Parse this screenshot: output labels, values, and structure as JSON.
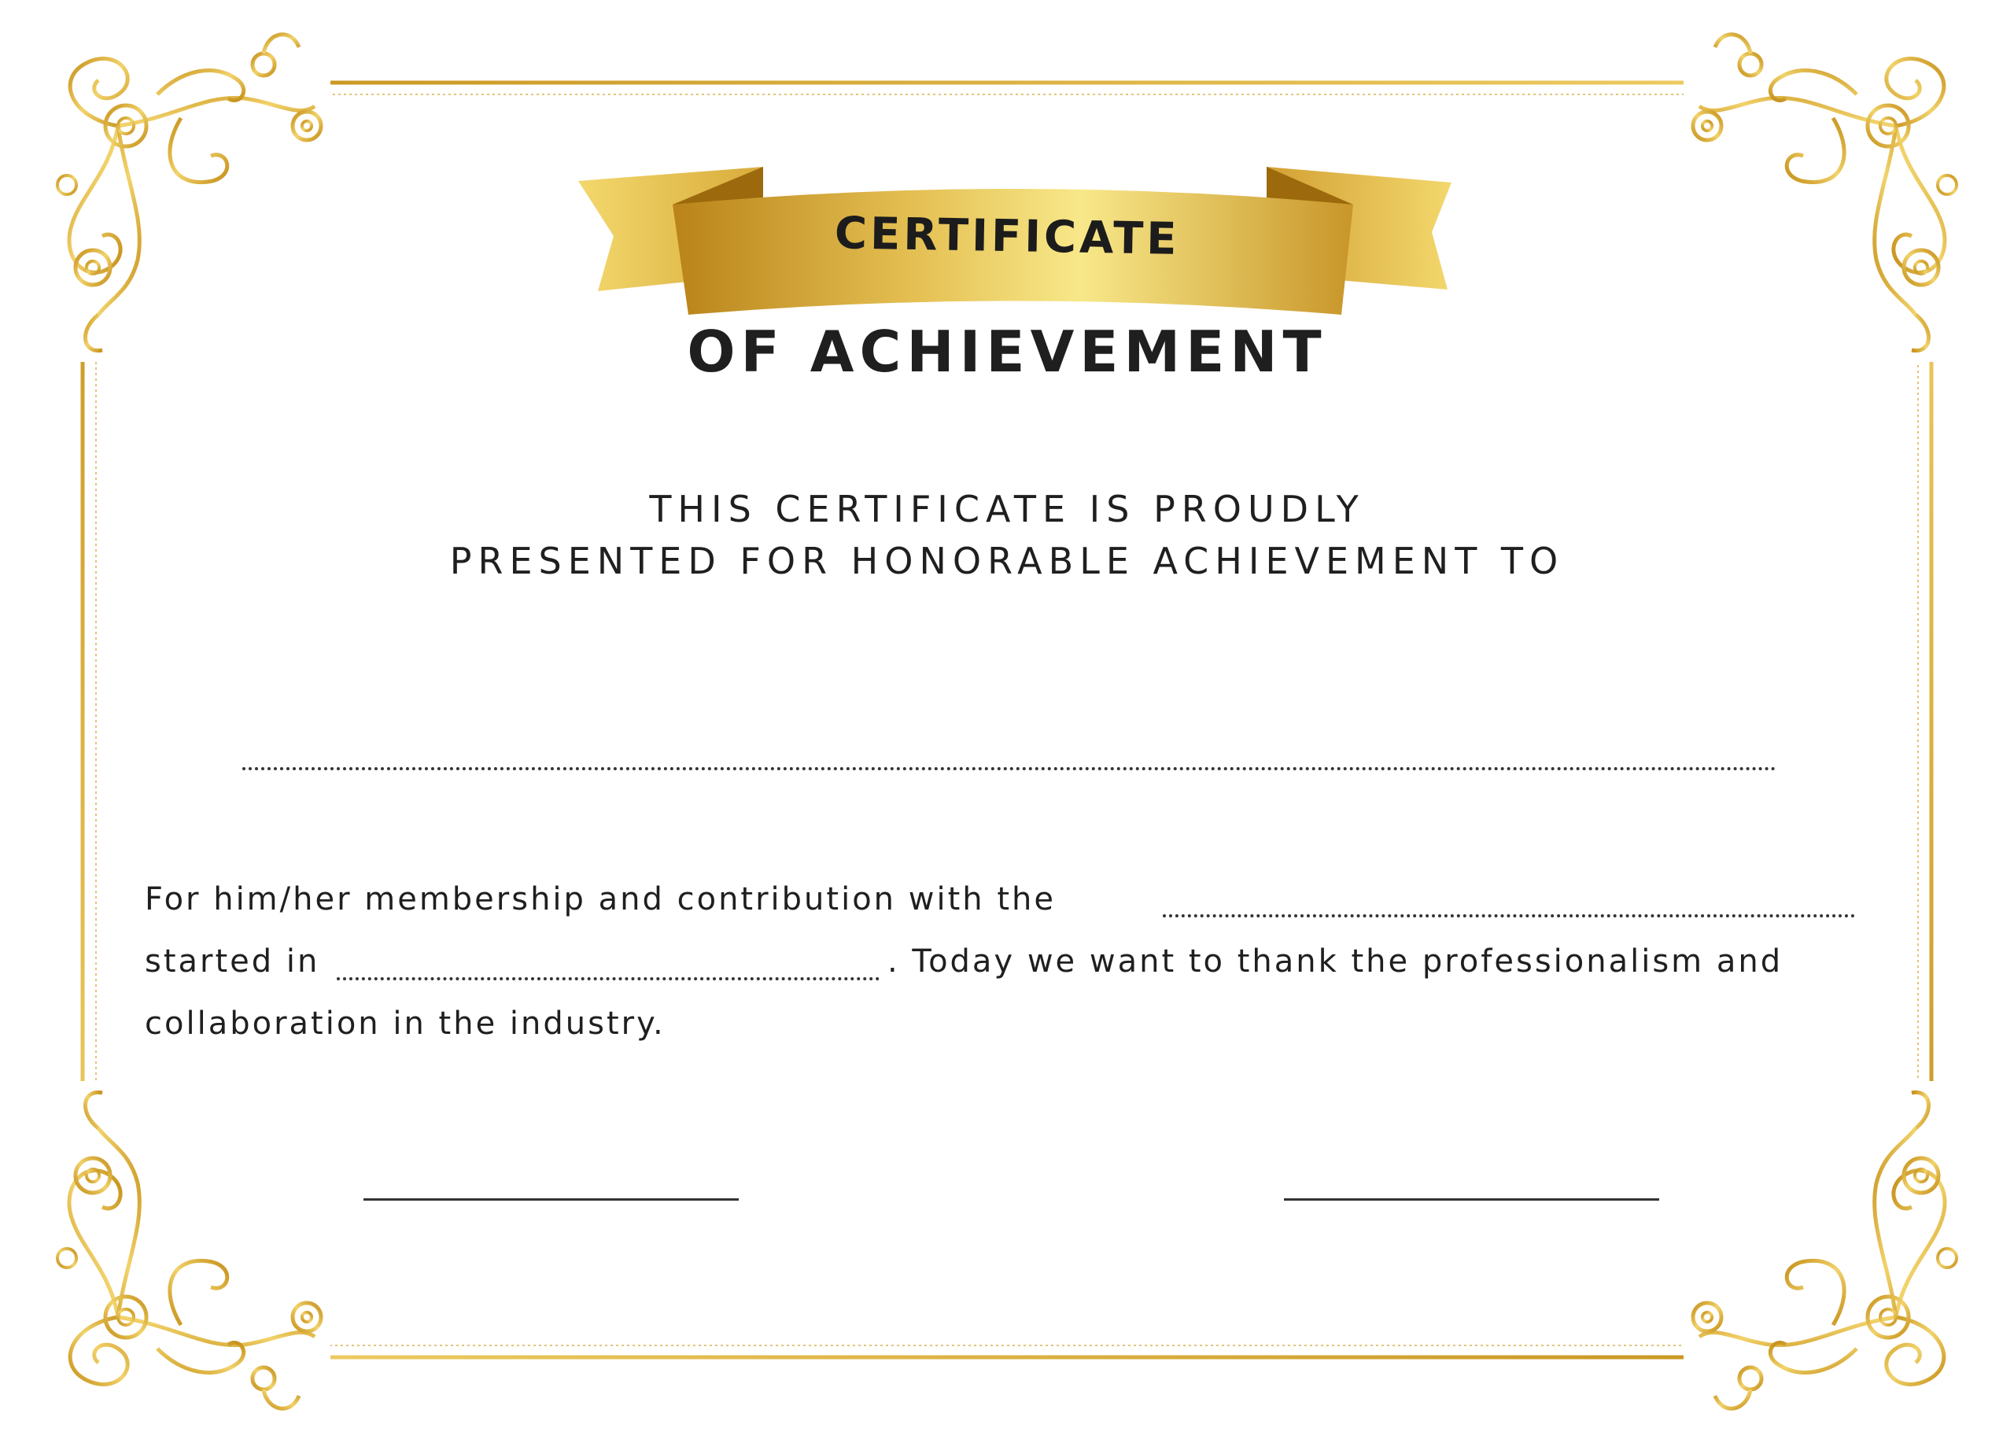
{
  "certificate": {
    "title_ribbon": "CERTIFICATE",
    "subtitle": "OF ACHIEVEMENT",
    "presented_line1": "THIS CERTIFICATE IS PROUDLY",
    "presented_line2": "PRESENTED FOR HONORABLE ACHIEVEMENT TO",
    "body_line1": "For him/her membership and contribution with the",
    "body_line2_start": "started in",
    "body_line2_end": ". Today we want to thank the professionalism and",
    "body_line3": "collaboration in the industry."
  },
  "colors": {
    "gold_dark": "#b8860b",
    "gold_light": "#f6e27a",
    "gold_mid": "#d4a437",
    "text": "#1f1f1f"
  },
  "icons": {
    "corner_ornament": "gold-flourish-icon",
    "ribbon": "gold-ribbon-banner"
  }
}
